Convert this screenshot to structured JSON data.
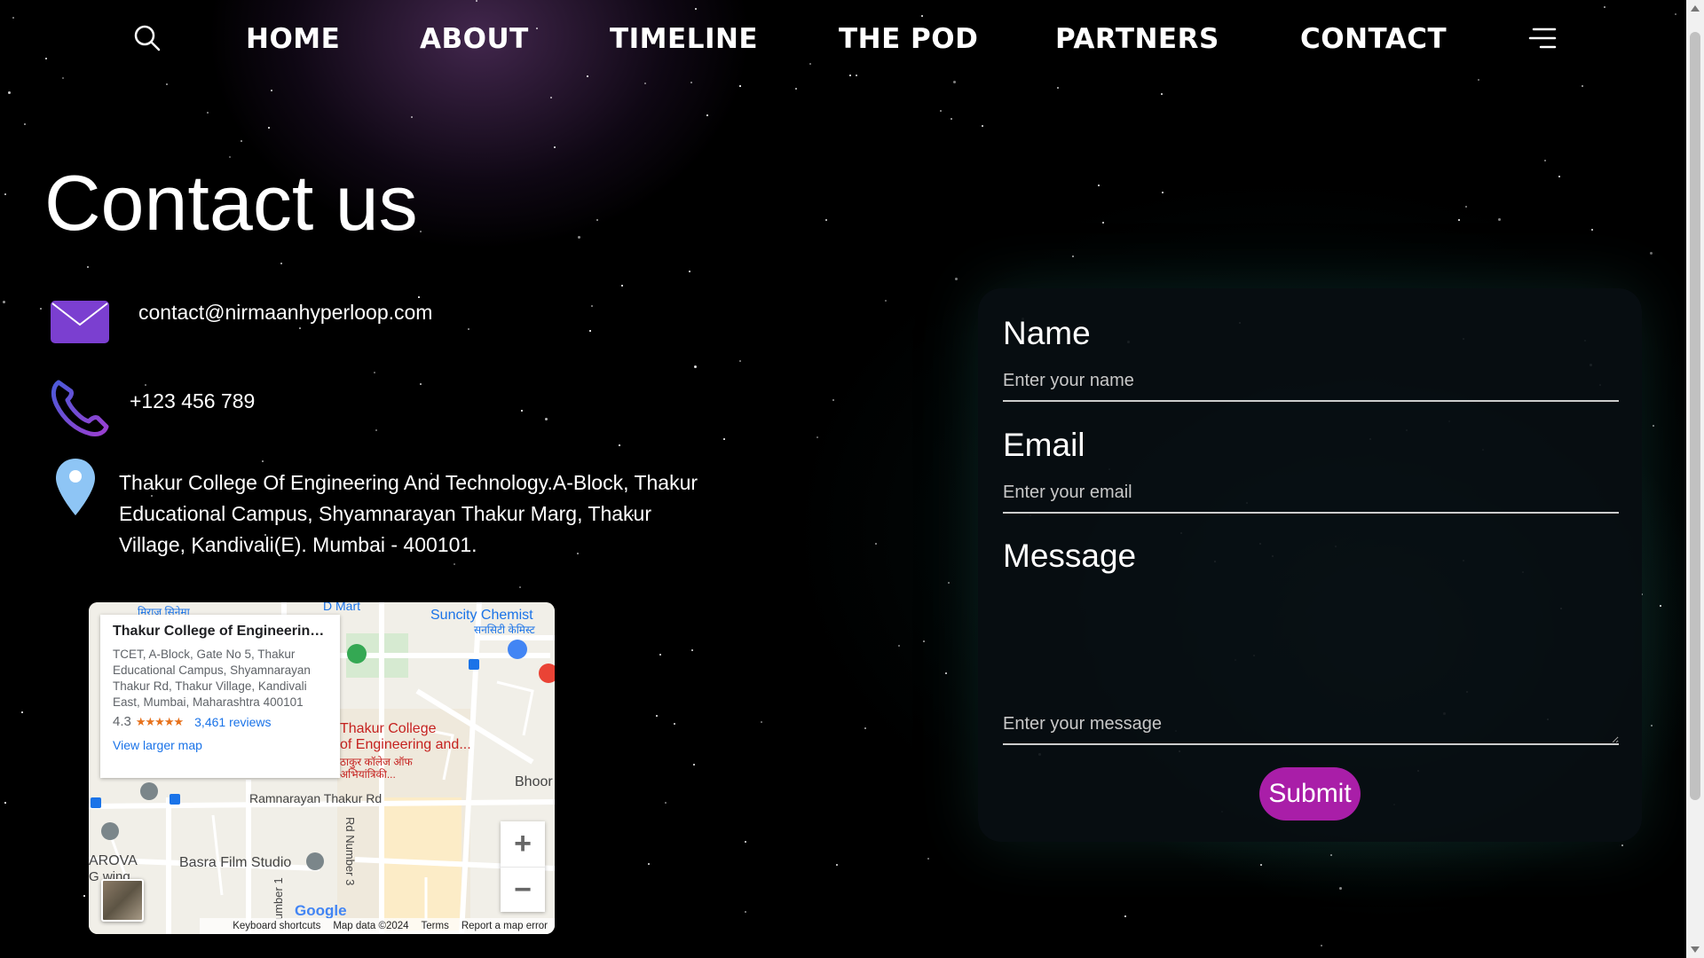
{
  "nav": {
    "items": [
      {
        "label": "HOME"
      },
      {
        "label": "ABOUT"
      },
      {
        "label": "TIMELINE"
      },
      {
        "label": "THE POD"
      },
      {
        "label": "PARTNERS"
      },
      {
        "label": "CONTACT"
      }
    ],
    "search_icon": "search-icon",
    "menu_icon": "hamburger-menu-icon"
  },
  "page": {
    "title": "Contact us"
  },
  "contact": {
    "email": "contact@nirmaanhyperloop.com",
    "phone": "+123 456 789",
    "address": "Thakur College Of Engineering And Technology.A-Block, Thakur Educational Campus, Shyamnarayan Thakur Marg, Thakur Village, Kandivali(E). Mumbai - 400101.",
    "email_icon": "envelope-icon",
    "phone_icon": "phone-icon",
    "location_icon": "location-pin-icon",
    "colors": {
      "envelope": "#7b3fd0",
      "phone": "#6a3fc8",
      "pin": "#8ec5f5"
    }
  },
  "map": {
    "card_title": "Thakur College of Engineering...",
    "card_address": "TCET, A-Block, Gate No 5, Thakur Educational Campus, Shyamnarayan Thakur Rd, Thakur Village, Kandivali East, Mumbai, Maharashtra 400101",
    "rating": "4.3",
    "stars": "★★★★★",
    "reviews": "3,461 reviews",
    "view_larger": "View larger map",
    "labels": {
      "dmart": "D Mart",
      "suncity": "Suncity Chemist",
      "suncity_hi": "सनसिटी केमिस्ट",
      "tcet_1": "Thakur College",
      "tcet_2": "of Engineering and...",
      "tcet_hi_1": "ठाकुर कॉलेज ऑफ",
      "tcet_hi_2": "अभियांत्रिकी...",
      "road": "Ramnarayan Thakur Rd",
      "rd_number": "Rd Number 3",
      "basra": "Basra Film Studio",
      "arova": "AROVA",
      "gwing": "G wing",
      "bhoo": "Bhoor",
      "mirage": "मिराज सिनेमा",
      "number1": "umber 1"
    },
    "zoom_in": "+",
    "zoom_out": "−",
    "footer": {
      "shortcuts": "Keyboard shortcuts",
      "data": "Map data ©2024",
      "terms": "Terms",
      "report": "Report a map error"
    },
    "google": "Google"
  },
  "form": {
    "name_label": "Name",
    "name_placeholder": "Enter your name",
    "email_label": "Email",
    "email_placeholder": "Enter your email",
    "message_label": "Message",
    "message_placeholder": "Enter your message",
    "submit_label": "Submit",
    "submit_color": "#a91ea8"
  }
}
